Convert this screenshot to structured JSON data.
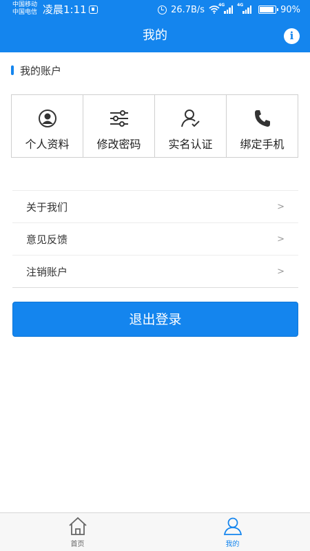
{
  "status_bar": {
    "carrier_1": "中国移动",
    "carrier_2": "中国电信",
    "time": "凌晨1:11",
    "net_speed": "26.7B/s",
    "network_1": "4G",
    "network_2": "4G",
    "battery": "90%",
    "battery_level": 0.9,
    "icons": [
      "shield-icon",
      "alarm-icon",
      "wifi-icon",
      "signal-icon",
      "battery-icon"
    ]
  },
  "header": {
    "title": "我的",
    "info_icon": "info-icon",
    "info_glyph": "i"
  },
  "account_section": {
    "title": "我的账户",
    "items": [
      {
        "label": "个人资料",
        "icon": "profile-icon"
      },
      {
        "label": "修改密码",
        "icon": "sliders-icon"
      },
      {
        "label": "实名认证",
        "icon": "user-verify-icon"
      },
      {
        "label": "绑定手机",
        "icon": "phone-icon"
      }
    ]
  },
  "menu": {
    "items": [
      {
        "label": "关于我们",
        "arrow": ">"
      },
      {
        "label": "意见反馈",
        "arrow": ">"
      },
      {
        "label": "注销账户",
        "arrow": ">"
      }
    ]
  },
  "logout_button": "退出登录",
  "tabbar": {
    "items": [
      {
        "label": "首页",
        "icon": "home-icon",
        "active": false
      },
      {
        "label": "我的",
        "icon": "user-icon",
        "active": true
      }
    ]
  },
  "colors": {
    "primary": "#1485ee",
    "text": "#333333",
    "border": "#cfcfcf",
    "tab_inactive": "#666666"
  }
}
